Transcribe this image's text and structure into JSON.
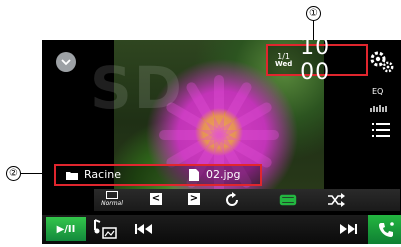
{
  "callouts": {
    "one": "①",
    "two": "②"
  },
  "header": {
    "date_day": "1/1",
    "date_weekday": "Wed",
    "time": "10 00",
    "eq_label": "EQ"
  },
  "watermark": "SD",
  "info": {
    "folder_name": "Racine",
    "file_name": "02.jpg"
  },
  "controls": {
    "normal_label": "Normal",
    "prev_folder_glyph": "<",
    "next_folder_glyph": ">"
  },
  "bottom": {
    "play_pause_label": "▶/II"
  },
  "colors": {
    "highlight": "#e0262e",
    "accent_green": "#23b640"
  },
  "icons": [
    "collapse-icon",
    "settings-icon",
    "eq-icon",
    "list-icon",
    "folder-icon",
    "file-icon",
    "rotate-icon",
    "repeat-icon",
    "shuffle-icon",
    "source-icon",
    "previous-track-icon",
    "next-track-icon",
    "phone-icon"
  ]
}
